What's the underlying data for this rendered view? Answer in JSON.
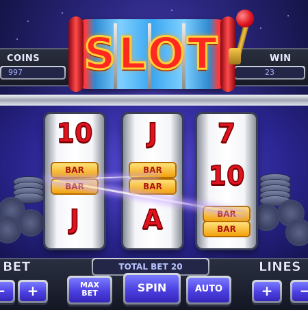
{
  "title": "SLOT",
  "coins": {
    "label": "COINS",
    "value": "997"
  },
  "win": {
    "label": "WIN",
    "value": "23"
  },
  "reels": [
    {
      "symbols": [
        "10",
        "BAR",
        "BAR",
        "J"
      ]
    },
    {
      "symbols": [
        "J",
        "BAR",
        "BAR",
        "A"
      ]
    },
    {
      "symbols": [
        "7",
        "10",
        "BAR",
        "BAR"
      ]
    }
  ],
  "total_bet": {
    "label": "TOTAL BET 20"
  },
  "bet": {
    "label": "BET",
    "minus": "−",
    "plus": "+"
  },
  "lines": {
    "label": "LINES",
    "plus": "+",
    "minus": "−"
  },
  "buttons": {
    "max_bet_line1": "MAX",
    "max_bet_line2": "BET",
    "spin": "SPIN",
    "auto": "AUTO"
  },
  "colors": {
    "accent": "#4b3fe0",
    "symbol_red": "#e0131f",
    "bar_gold": "#f2a10c",
    "background": "#2c2780"
  }
}
